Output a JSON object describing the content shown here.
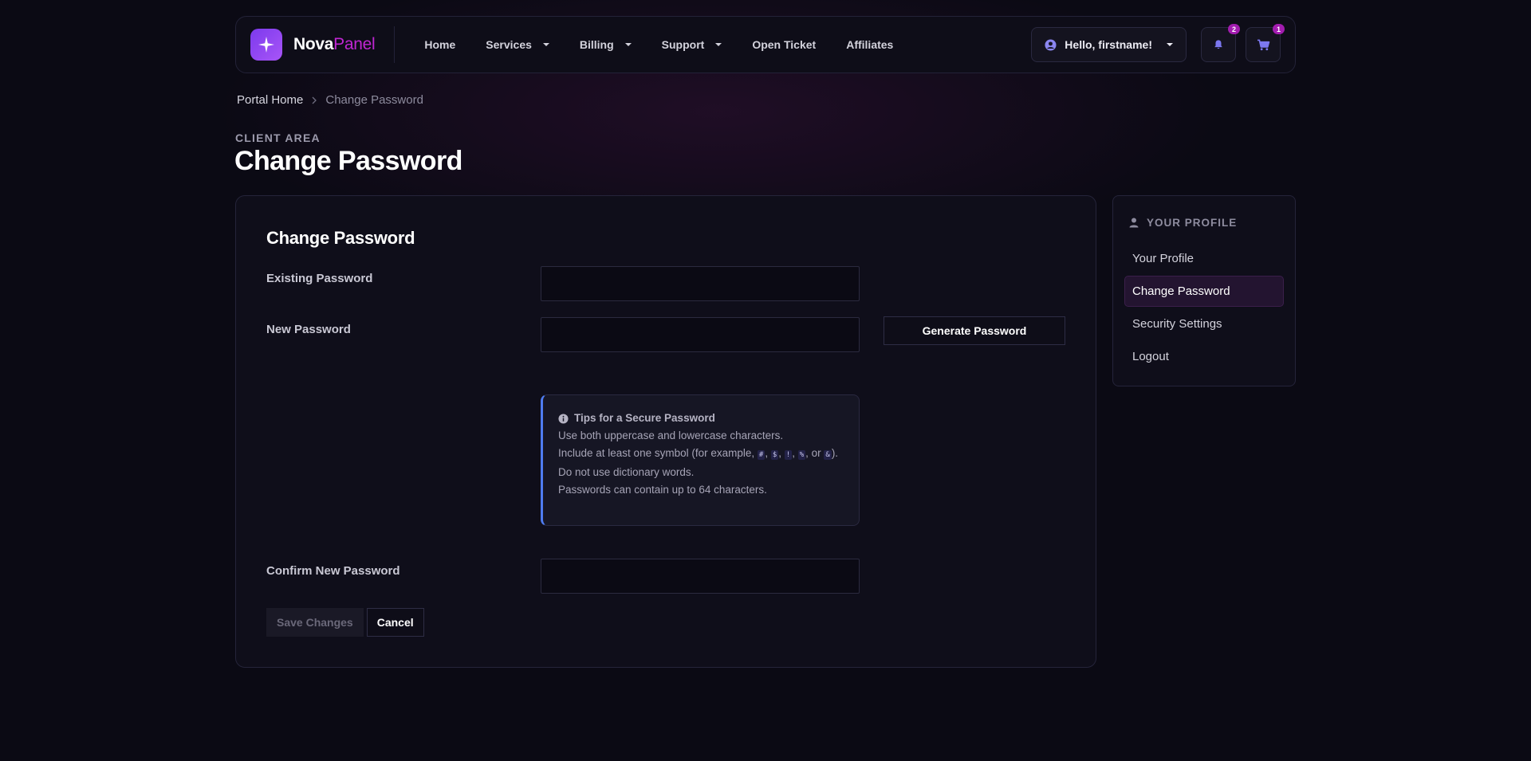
{
  "brand": {
    "name_main": "Nova",
    "name_accent": "Panel"
  },
  "nav": {
    "items": [
      {
        "label": "Home",
        "dropdown": false
      },
      {
        "label": "Services",
        "dropdown": true
      },
      {
        "label": "Billing",
        "dropdown": true
      },
      {
        "label": "Support",
        "dropdown": true
      },
      {
        "label": "Open Ticket",
        "dropdown": false
      },
      {
        "label": "Affiliates",
        "dropdown": false
      }
    ],
    "user_greeting": "Hello, firstname!",
    "notifications_count": "2",
    "cart_count": "1"
  },
  "breadcrumb": {
    "home": "Portal Home",
    "current": "Change Password"
  },
  "header": {
    "eyebrow": "CLIENT AREA",
    "title": "Change Password"
  },
  "form": {
    "title": "Change Password",
    "existing_label": "Existing Password",
    "existing_value": "",
    "new_label": "New Password",
    "new_value": "",
    "generate_label": "Generate Password",
    "confirm_label": "Confirm New Password",
    "confirm_value": "",
    "save_label": "Save Changes",
    "cancel_label": "Cancel"
  },
  "tips": {
    "title": "Tips for a Secure Password",
    "line1": "Use both uppercase and lowercase characters.",
    "line2_prefix": "Include at least one symbol (for example, ",
    "symbols": [
      "#",
      "$",
      "!",
      "%",
      "&"
    ],
    "line2_suffix": ").",
    "line3": "Do not use dictionary words.",
    "line4": "Passwords can contain up to 64 characters."
  },
  "sidebar": {
    "heading": "YOUR PROFILE",
    "items": [
      {
        "label": "Your Profile",
        "active": false
      },
      {
        "label": "Change Password",
        "active": true
      },
      {
        "label": "Security Settings",
        "active": false
      },
      {
        "label": "Logout",
        "active": false
      }
    ]
  },
  "colors": {
    "accent": "#c026d3",
    "brand_gradient_start": "#7c3aed",
    "tips_border": "#4f7cf0",
    "badge": "#a21caf"
  }
}
